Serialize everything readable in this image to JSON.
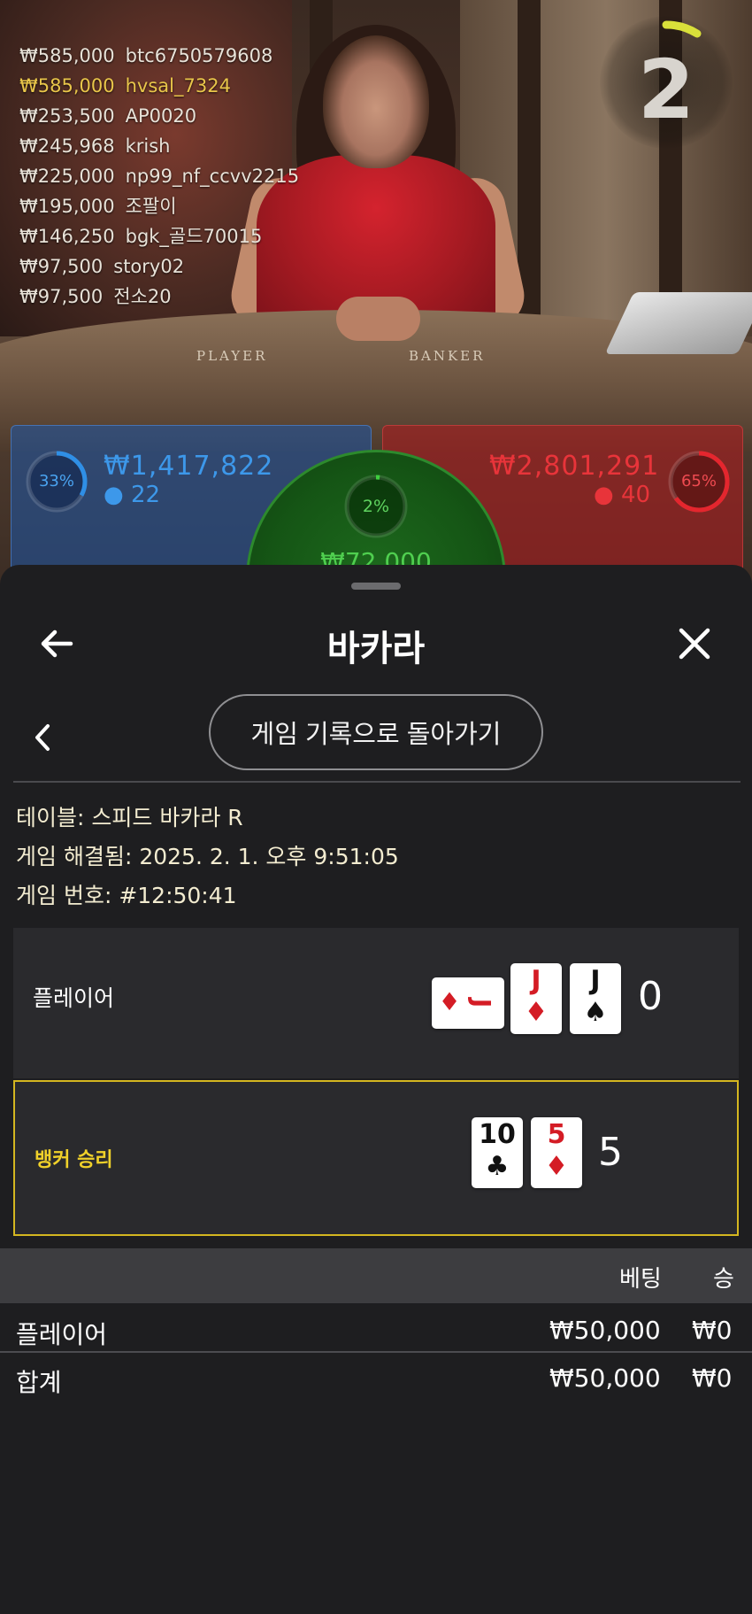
{
  "stream": {
    "table_player_label": "PLAYER",
    "table_banker_label": "BANKER",
    "timer_value": "2",
    "leaderboard": [
      {
        "amount": "₩585,000",
        "name": "btc6750579608",
        "highlight": false
      },
      {
        "amount": "₩585,000",
        "name": "hvsal_7324",
        "highlight": true
      },
      {
        "amount": "₩253,500",
        "name": "AP0020",
        "highlight": false
      },
      {
        "amount": "₩245,968",
        "name": "krish",
        "highlight": false
      },
      {
        "amount": "₩225,000",
        "name": "np99_nf_ccvv2215",
        "highlight": false
      },
      {
        "amount": "₩195,000",
        "name": "조팔이",
        "highlight": false
      },
      {
        "amount": "₩146,250",
        "name": "bgk_골드70015",
        "highlight": false
      },
      {
        "amount": "₩97,500",
        "name": "story02",
        "highlight": false
      },
      {
        "amount": "₩97,500",
        "name": "전소20",
        "highlight": false
      }
    ],
    "player_bet": {
      "percent": "33%",
      "percent_value": 0.33,
      "amount": "₩1,417,822",
      "count": "22",
      "color": "#2f8fe6"
    },
    "banker_bet": {
      "percent": "65%",
      "percent_value": 0.65,
      "amount": "₩2,801,291",
      "count": "40",
      "color": "#e4262e"
    },
    "tie_bet": {
      "percent": "2%",
      "percent_value": 0.02,
      "amount": "₩72,000",
      "color": "#3fcf3f"
    }
  },
  "sheet": {
    "title": "바카라",
    "history_button": "게임 기록으로 돌아가기",
    "info": {
      "table": "테이블: 스피드 바카라 R",
      "resolved": "게임 해결됨: 2025. 2. 1. 오후 9:51:05",
      "game_number": "게임 번호: #12:50:41"
    },
    "player_hand": {
      "label": "플레이어",
      "score": "0",
      "cards": [
        {
          "rank": "J",
          "suit": "♦",
          "color": "red",
          "sideways": true
        },
        {
          "rank": "J",
          "suit": "♦",
          "color": "red",
          "sideways": false
        },
        {
          "rank": "J",
          "suit": "♠",
          "color": "black",
          "sideways": false
        }
      ]
    },
    "banker_hand": {
      "label": "뱅커 승리",
      "score": "5",
      "cards": [
        {
          "rank": "10",
          "suit": "♣",
          "color": "black",
          "sideways": false
        },
        {
          "rank": "5",
          "suit": "♦",
          "color": "red",
          "sideways": false
        }
      ]
    },
    "bets_table": {
      "col_bet": "베팅",
      "col_win": "승",
      "rows": [
        {
          "label": "플레이어",
          "bet": "₩50,000",
          "win": "₩0"
        },
        {
          "label": "합계",
          "bet": "₩50,000",
          "win": "₩0"
        }
      ]
    },
    "accent_color": "#d4b620"
  }
}
